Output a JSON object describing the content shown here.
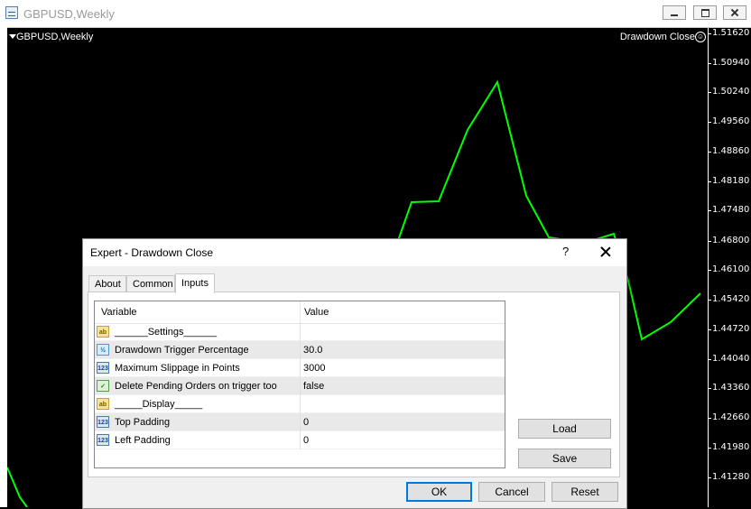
{
  "window": {
    "title": "GBPUSD,Weekly"
  },
  "chart": {
    "symbol_label": "GBPUSD,Weekly",
    "ea_label": "Drawdown Close",
    "ea_smiley": "☺",
    "line_color": "#00ff00",
    "price_ticks": [
      "1.51620",
      "1.50940",
      "1.50240",
      "1.49560",
      "1.48860",
      "1.48180",
      "1.47480",
      "1.46800",
      "1.46100",
      "1.45420",
      "1.44720",
      "1.44040",
      "1.43360",
      "1.42660",
      "1.41980",
      "1.41280"
    ]
  },
  "dialog": {
    "title": "Expert - Drawdown Close",
    "help": "?",
    "tabs": [
      "About",
      "Common",
      "Inputs"
    ],
    "active_tab": "Inputs",
    "grid": {
      "col_variable": "Variable",
      "col_value": "Value",
      "rows": [
        {
          "icon": "ab-string-icon",
          "icon_text": "ab",
          "variable": "______Settings______",
          "value": ""
        },
        {
          "icon": "double-icon",
          "icon_text": "½",
          "variable": "Drawdown Trigger Percentage",
          "value": "30.0"
        },
        {
          "icon": "int-icon",
          "icon_text": "123",
          "variable": "Maximum Slippage in Points",
          "value": "3000"
        },
        {
          "icon": "bool-icon",
          "icon_text": "✓",
          "variable": "Delete Pending Orders on trigger too",
          "value": "false"
        },
        {
          "icon": "ab-string-icon",
          "icon_text": "ab",
          "variable": "_____Display_____",
          "value": ""
        },
        {
          "icon": "int-icon",
          "icon_text": "123",
          "variable": "Top Padding",
          "value": "0"
        },
        {
          "icon": "int-icon",
          "icon_text": "123",
          "variable": "Left Padding",
          "value": "0"
        }
      ]
    },
    "buttons": {
      "load": "Load",
      "save": "Save",
      "ok": "OK",
      "cancel": "Cancel",
      "reset": "Reset"
    }
  }
}
